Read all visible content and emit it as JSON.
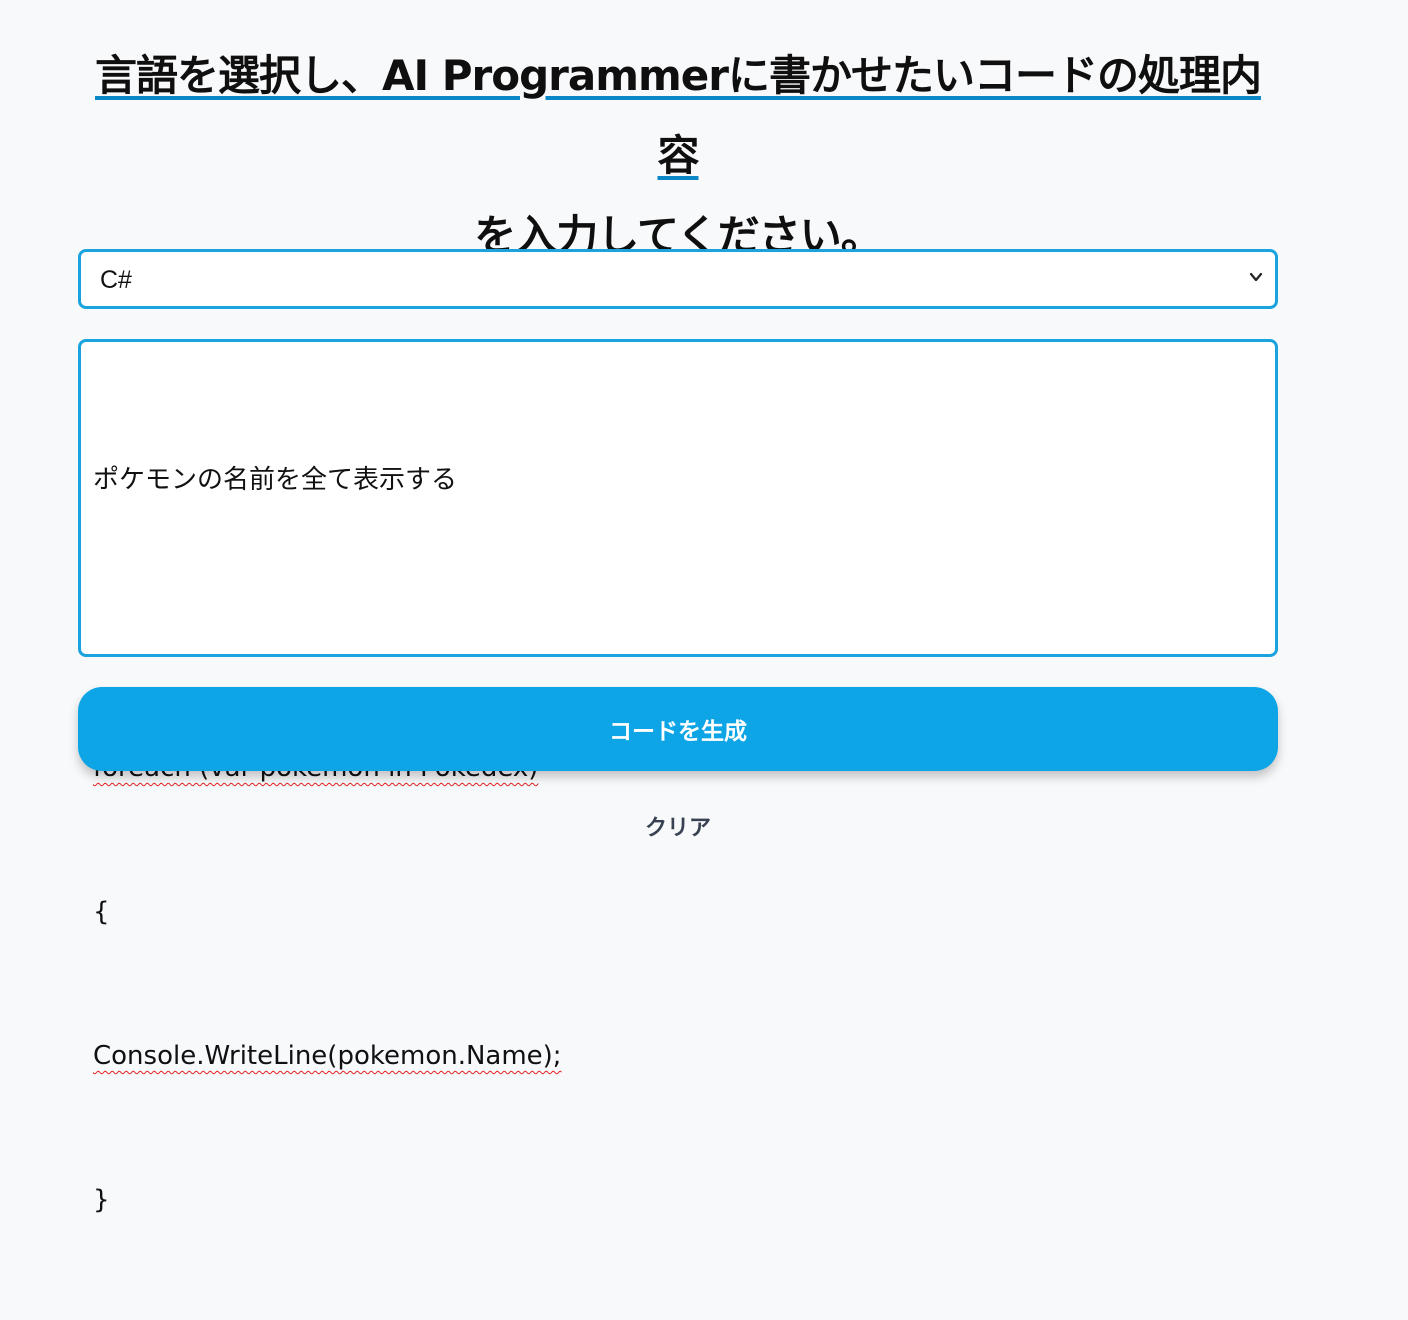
{
  "header": {
    "title_line1": "言語を選択し、AI Programmerに書かせたいコードの処理内容",
    "title_line2": "を入力してください。"
  },
  "language_select": {
    "selected_value": "C#"
  },
  "prompt_textarea": {
    "lines": [
      "ポケモンの名前を全て表示する",
      "",
      "foreach (var pokemon in Pokedex)",
      "{",
      "Console.WriteLine(pokemon.Name);",
      "}"
    ]
  },
  "actions": {
    "generate_label": "コードを生成",
    "clear_label": "クリア"
  },
  "colors": {
    "accent": "#1aa3dd",
    "button": "#0ea5e6",
    "underline": "#0b86c9",
    "background": "#f8f9fb"
  },
  "icons": {
    "select_arrow": "chevron-down-icon"
  }
}
